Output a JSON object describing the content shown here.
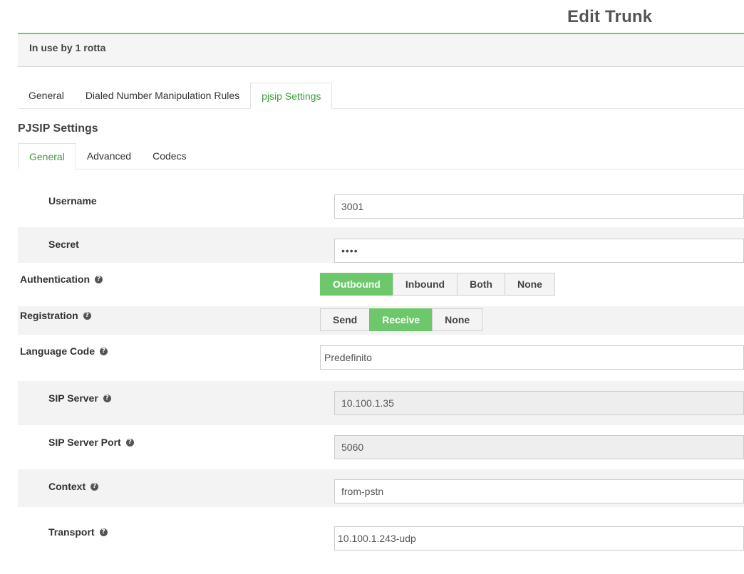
{
  "page": {
    "title": "Edit Trunk",
    "usage_notice": "In use by 1 rotta"
  },
  "top_tabs": [
    {
      "label": "General",
      "active": false
    },
    {
      "label": "Dialed Number Manipulation Rules",
      "active": false
    },
    {
      "label": "pjsip Settings",
      "active": true
    }
  ],
  "section": {
    "title": "PJSIP Settings"
  },
  "sub_tabs": [
    {
      "label": "General",
      "active": true
    },
    {
      "label": "Advanced",
      "active": false
    },
    {
      "label": "Codecs",
      "active": false
    }
  ],
  "form": {
    "username": {
      "label": "Username",
      "value": "3001"
    },
    "secret": {
      "label": "Secret",
      "value": "••••"
    },
    "authentication": {
      "label": "Authentication",
      "options": [
        "Outbound",
        "Inbound",
        "Both",
        "None"
      ],
      "selected": "Outbound"
    },
    "registration": {
      "label": "Registration",
      "options": [
        "Send",
        "Receive",
        "None"
      ],
      "selected": "Receive"
    },
    "language_code": {
      "label": "Language Code",
      "value": "Predefinito"
    },
    "sip_server": {
      "label": "SIP Server",
      "value": "10.100.1.35"
    },
    "sip_server_port": {
      "label": "SIP Server Port",
      "value": "5060"
    },
    "context": {
      "label": "Context",
      "value": "from-pstn"
    },
    "transport": {
      "label": "Transport",
      "value": "10.100.1.243-udp"
    }
  },
  "help_icon_glyph": "?",
  "colors": {
    "accent_green": "#6cc86a",
    "active_tab_text": "#3a9d3a"
  }
}
